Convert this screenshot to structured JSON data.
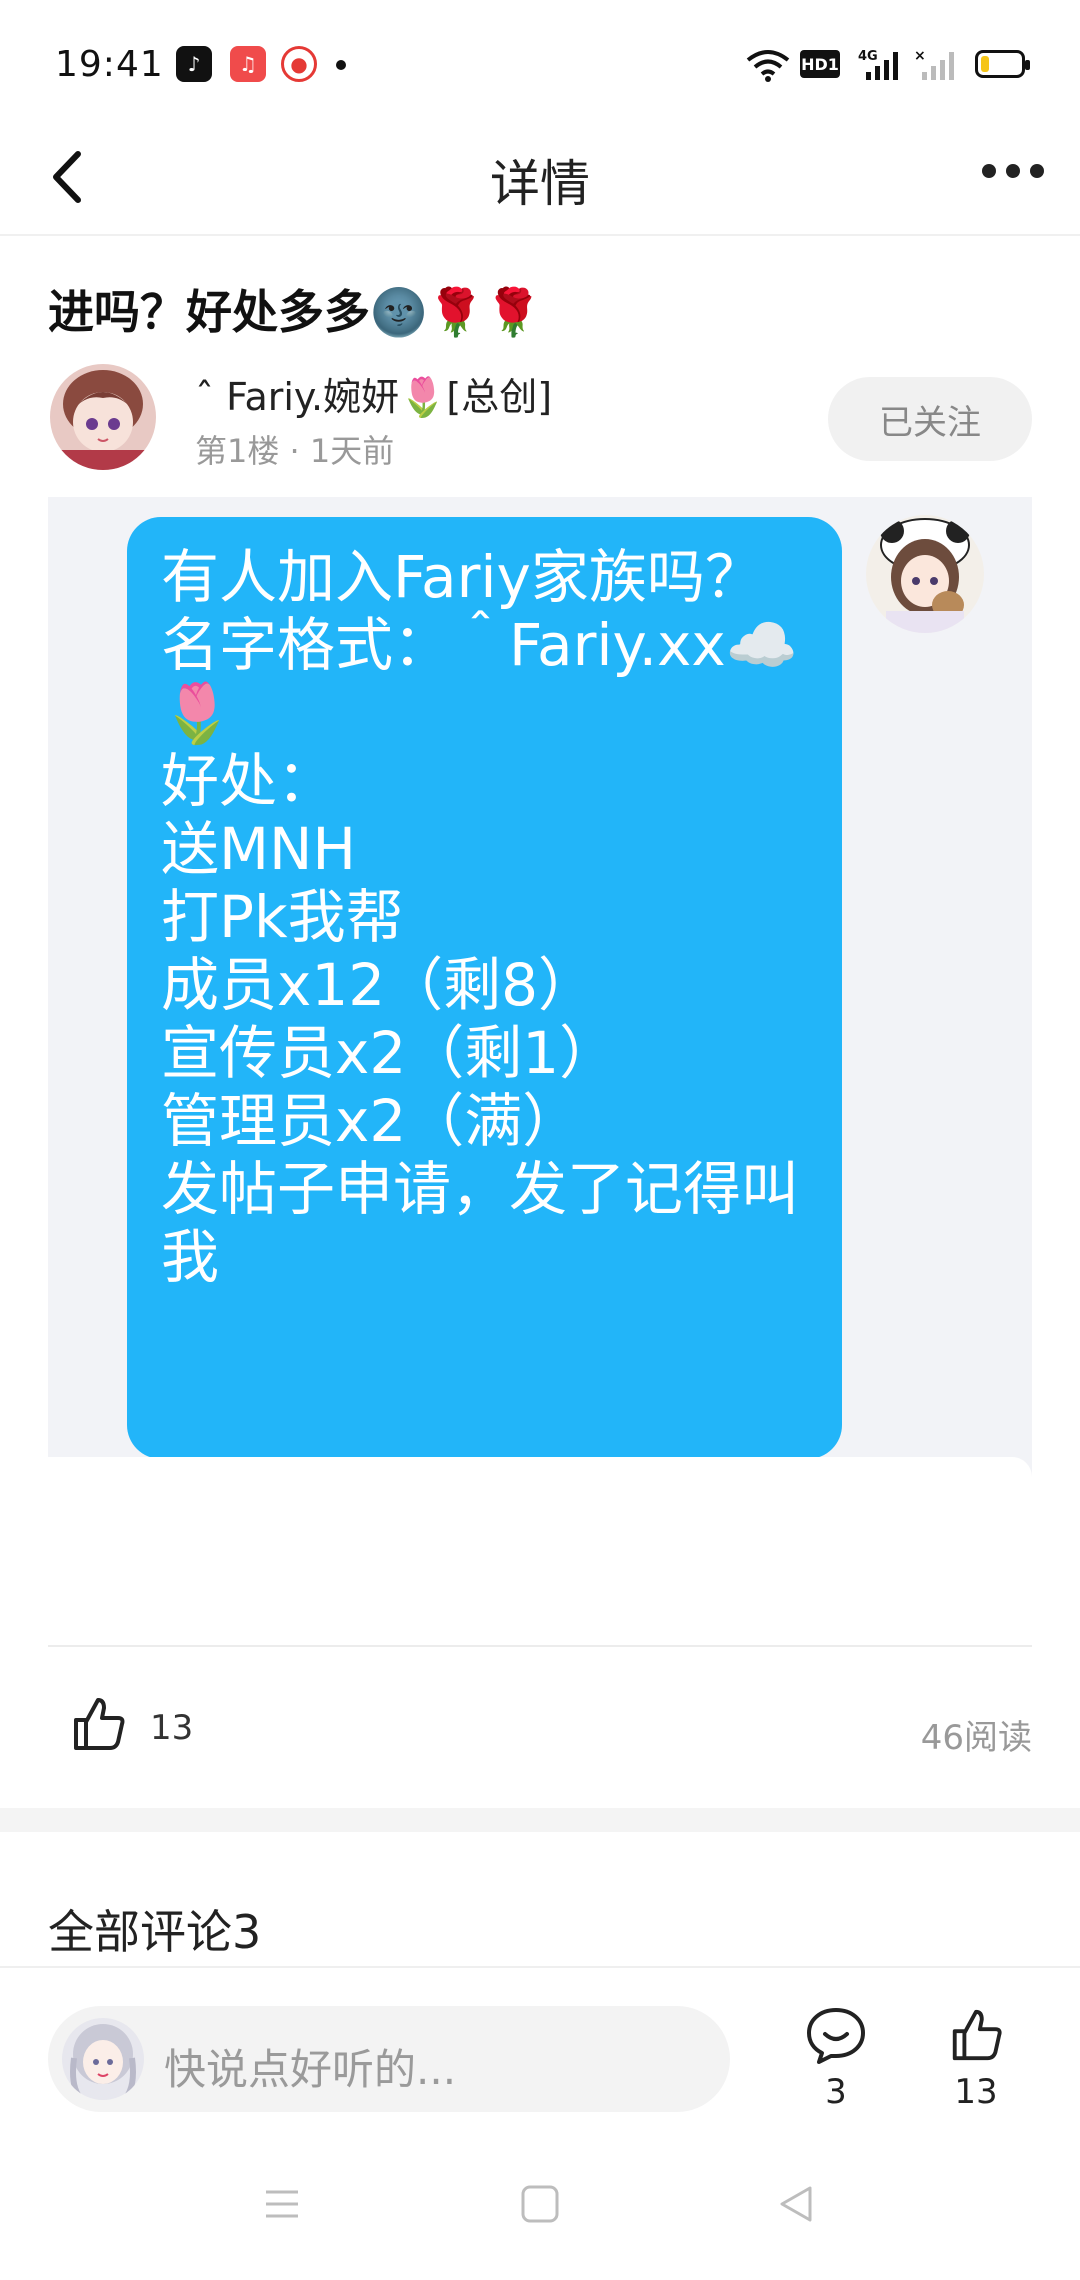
{
  "status_bar": {
    "time": "19:41",
    "notification_icons": [
      "tiktok-icon",
      "music-icon",
      "live-icon"
    ],
    "system_icons": [
      "wifi-icon",
      "hd-icon",
      "4g-signal-icon",
      "no-signal-icon",
      "battery-icon"
    ],
    "hd_label": "HD1",
    "battery_level": 0.2
  },
  "header": {
    "title": "详情",
    "back_icon": "chevron-left-icon",
    "more_icon": "more-dots-icon"
  },
  "post": {
    "title": "进吗？好处多多🌚🌹🌹",
    "author_name": "ˆ Fariy.婉妍🌷[总创]",
    "meta": "第1楼 · 1天前",
    "follow_label": "已关注",
    "image_text": [
      "有人加入Fariy家族吗？",
      "名字格式：＾Fariy.xx☁️",
      "🌷",
      "好处：",
      "送MNH",
      "打Pk我帮",
      "成员x12（剩8）",
      "宣传员x2（剩1）",
      "管理员x2（满）",
      "发帖子申请，发了记得叫",
      "我"
    ],
    "like_count": "13",
    "read_count": "46阅读"
  },
  "comments": {
    "title": "全部评论3"
  },
  "bottom_bar": {
    "input_placeholder": "快说点好听的...",
    "comment_count": "3",
    "like_count": "13"
  },
  "colors": {
    "bubble": "#22b5f9",
    "accent_text": "#111111",
    "muted_text": "#999999"
  }
}
